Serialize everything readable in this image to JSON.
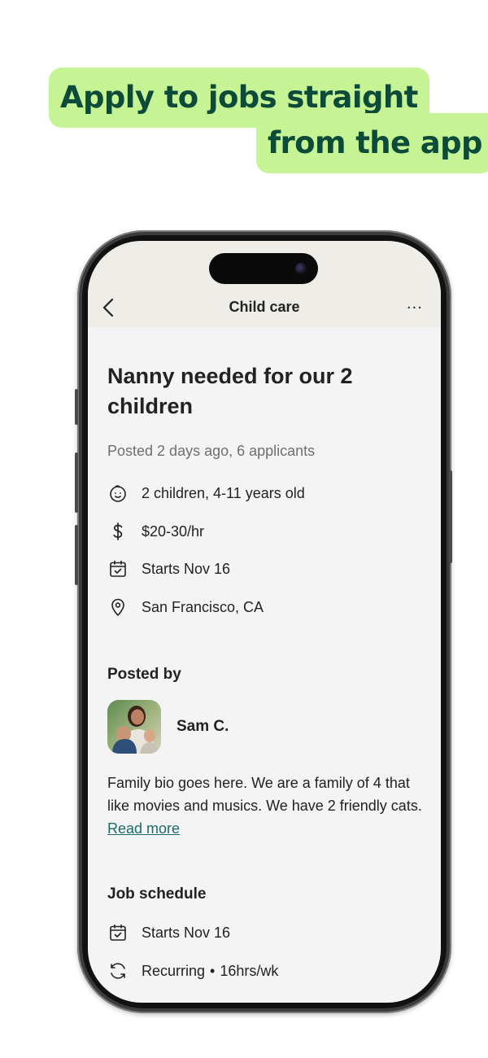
{
  "headline": {
    "line1": "Apply to jobs straight",
    "line2": "from the app"
  },
  "nav": {
    "title": "Child care",
    "more_label": "···"
  },
  "job": {
    "title": "Nanny needed for our 2 children",
    "posted": "Posted 2 days ago, 6 applicants",
    "details": [
      {
        "icon": "child-face-icon",
        "text": "2 children, 4-11 years old"
      },
      {
        "icon": "dollar-icon",
        "text": "$20-30/hr"
      },
      {
        "icon": "calendar-check-icon",
        "text": "Starts Nov 16"
      },
      {
        "icon": "location-pin-icon",
        "text": "San Francisco, CA"
      }
    ]
  },
  "poster": {
    "heading": "Posted by",
    "name": "Sam C.",
    "bio": "Family bio goes here. We are a family of 4 that like movies and musics. We have 2 friendly cats.",
    "read_more": "Read more"
  },
  "schedule": {
    "heading": "Job schedule",
    "items": [
      {
        "icon": "calendar-check-icon",
        "text": "Starts Nov 16"
      },
      {
        "icon": "recurring-icon",
        "text": "Recurring",
        "extra": "16hrs/wk"
      }
    ]
  },
  "colors": {
    "headline_bg": "#c6f494",
    "headline_text": "#0c4b39",
    "link": "#1d6b6b",
    "nav_bg": "#eeede8"
  }
}
